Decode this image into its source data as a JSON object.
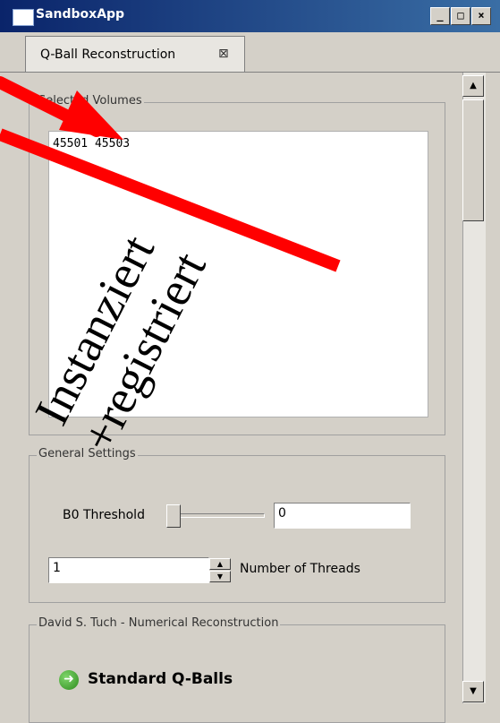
{
  "window": {
    "title": "SandboxApp",
    "controls": {
      "minimize": "_",
      "maximize": "□",
      "close": "×"
    }
  },
  "tab": {
    "label": "Q-Ball Reconstruction",
    "close_glyph": "⊠"
  },
  "selected_volumes": {
    "group_title": "Selected Volumes",
    "content": "45501  45503"
  },
  "general_settings": {
    "group_title": "General Settings",
    "b0_label": "B0 Threshold",
    "b0_value": "0",
    "threads_value": "1",
    "threads_label": "Number of Threads"
  },
  "tuch_group": {
    "group_title": "David S. Tuch - Numerical Reconstruction",
    "standard_qballs_label": "Standard Q-Balls"
  },
  "annotations": {
    "text1": "Instanziert",
    "text2": "+registriert",
    "arrow_color": "#ff0000"
  },
  "colors": {
    "titlebar_start": "#0a246a",
    "titlebar_end": "#3a6ea5",
    "window_bg": "#d4d0c8"
  }
}
